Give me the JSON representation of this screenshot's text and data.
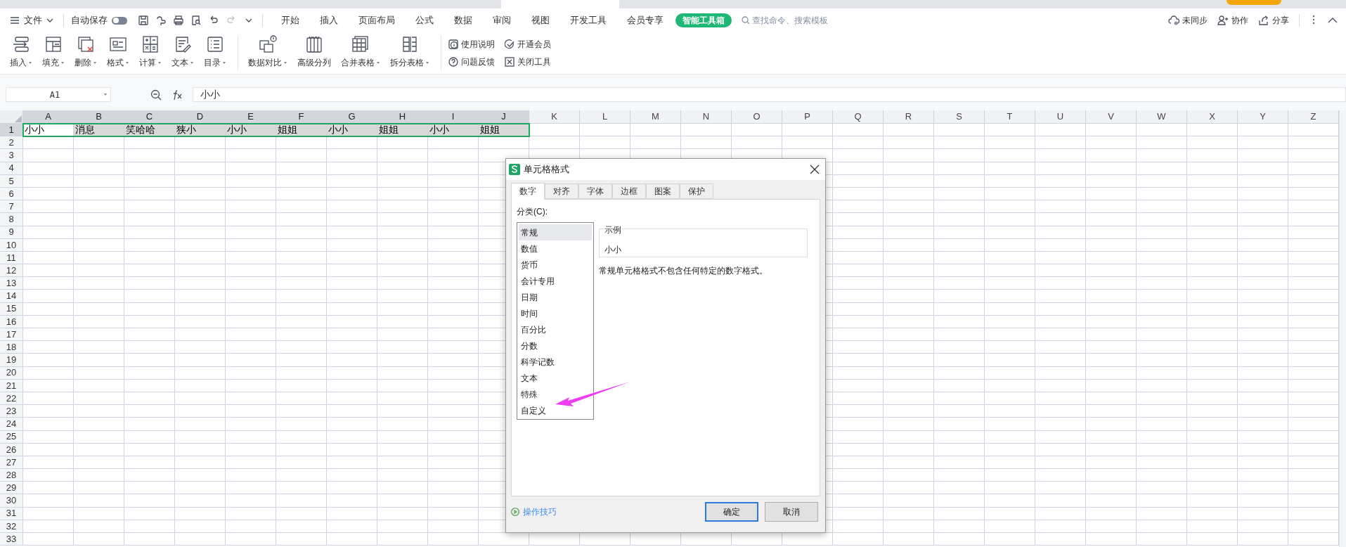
{
  "menu": {
    "file": "文件",
    "autosave": {
      "label": "自动保存",
      "on": false
    },
    "tabs": [
      {
        "label": "开始",
        "selected": false
      },
      {
        "label": "插入",
        "selected": false
      },
      {
        "label": "页面布局",
        "selected": false
      },
      {
        "label": "公式",
        "selected": false
      },
      {
        "label": "数据",
        "selected": false
      },
      {
        "label": "审阅",
        "selected": false
      },
      {
        "label": "视图",
        "selected": false
      },
      {
        "label": "开发工具",
        "selected": false
      },
      {
        "label": "会员专享",
        "selected": false
      },
      {
        "label": "智能工具箱",
        "selected": true
      }
    ],
    "search": {
      "placeholder": "查找命令、搜索模板"
    },
    "actions": [
      "未同步",
      "协作",
      "分享"
    ]
  },
  "ribbon": {
    "groups": [
      [
        {
          "label": "插入",
          "dropdown": true
        },
        {
          "label": "填充",
          "dropdown": true
        },
        {
          "label": "删除",
          "dropdown": true
        },
        {
          "label": "格式",
          "dropdown": true
        },
        {
          "label": "计算",
          "dropdown": true
        },
        {
          "label": "文本",
          "dropdown": true
        },
        {
          "label": "目录",
          "dropdown": true
        }
      ],
      [
        {
          "label": "数据对比",
          "dropdown": true
        },
        {
          "label": "高级分列",
          "dropdown": false
        },
        {
          "label": "合并表格",
          "dropdown": true
        },
        {
          "label": "拆分表格",
          "dropdown": true
        }
      ]
    ],
    "links": [
      "使用说明",
      "问题反馈",
      "开通会员",
      "关闭工具"
    ]
  },
  "formula_bar": {
    "cell_ref": "A1",
    "value": "小小"
  },
  "sheet": {
    "columns": [
      {
        "label": "A",
        "selected": true
      },
      {
        "label": "B",
        "selected": true
      },
      {
        "label": "C",
        "selected": true
      },
      {
        "label": "D",
        "selected": true
      },
      {
        "label": "E",
        "selected": true
      },
      {
        "label": "F",
        "selected": true
      },
      {
        "label": "G",
        "selected": true
      },
      {
        "label": "H",
        "selected": true
      },
      {
        "label": "I",
        "selected": true
      },
      {
        "label": "J",
        "selected": true
      },
      {
        "label": "K",
        "selected": false
      },
      {
        "label": "L",
        "selected": false
      },
      {
        "label": "M",
        "selected": false
      },
      {
        "label": "N",
        "selected": false
      },
      {
        "label": "O",
        "selected": false
      },
      {
        "label": "P",
        "selected": false
      },
      {
        "label": "Q",
        "selected": false
      },
      {
        "label": "R",
        "selected": false
      },
      {
        "label": "S",
        "selected": false
      },
      {
        "label": "T",
        "selected": false
      },
      {
        "label": "U",
        "selected": false
      },
      {
        "label": "V",
        "selected": false
      },
      {
        "label": "W",
        "selected": false
      },
      {
        "label": "X",
        "selected": false
      },
      {
        "label": "Y",
        "selected": false
      },
      {
        "label": "Z",
        "selected": false
      }
    ],
    "rows": [
      {
        "label": "1",
        "selected": true,
        "cells": [
          {
            "value": "小小",
            "active": true
          },
          {
            "value": "消息",
            "active": false
          },
          {
            "value": "笑哈哈",
            "active": false
          },
          {
            "value": "狭小",
            "active": false
          },
          {
            "value": "小小",
            "active": false
          },
          {
            "value": "姐姐",
            "active": false
          },
          {
            "value": "小小",
            "active": false
          },
          {
            "value": "姐姐",
            "active": false
          },
          {
            "value": "小小",
            "active": false
          },
          {
            "value": "姐姐",
            "active": false
          }
        ]
      },
      {
        "label": "2",
        "selected": false
      },
      {
        "label": "3",
        "selected": false
      },
      {
        "label": "4",
        "selected": false
      },
      {
        "label": "5",
        "selected": false
      },
      {
        "label": "6",
        "selected": false
      },
      {
        "label": "7",
        "selected": false
      },
      {
        "label": "8",
        "selected": false
      },
      {
        "label": "9",
        "selected": false
      },
      {
        "label": "10",
        "selected": false
      },
      {
        "label": "11",
        "selected": false
      },
      {
        "label": "12",
        "selected": false
      },
      {
        "label": "13",
        "selected": false
      },
      {
        "label": "14",
        "selected": false
      },
      {
        "label": "15",
        "selected": false
      },
      {
        "label": "16",
        "selected": false
      },
      {
        "label": "17",
        "selected": false
      },
      {
        "label": "18",
        "selected": false
      },
      {
        "label": "19",
        "selected": false
      },
      {
        "label": "20",
        "selected": false
      },
      {
        "label": "21",
        "selected": false
      },
      {
        "label": "22",
        "selected": false
      },
      {
        "label": "23",
        "selected": false
      },
      {
        "label": "24",
        "selected": false
      },
      {
        "label": "25",
        "selected": false
      },
      {
        "label": "26",
        "selected": false
      },
      {
        "label": "27",
        "selected": false
      },
      {
        "label": "28",
        "selected": false
      },
      {
        "label": "29",
        "selected": false
      },
      {
        "label": "30",
        "selected": false
      },
      {
        "label": "31",
        "selected": false
      },
      {
        "label": "32",
        "selected": false
      },
      {
        "label": "33",
        "selected": false
      }
    ]
  },
  "dialog": {
    "title": "单元格格式",
    "tabs": [
      {
        "label": "数字",
        "selected": true
      },
      {
        "label": "对齐",
        "selected": false
      },
      {
        "label": "字体",
        "selected": false
      },
      {
        "label": "边框",
        "selected": false
      },
      {
        "label": "图案",
        "selected": false
      },
      {
        "label": "保护",
        "selected": false
      }
    ],
    "category_label": "分类(C):",
    "categories": [
      {
        "label": "常规",
        "selected": true
      },
      {
        "label": "数值",
        "selected": false
      },
      {
        "label": "货币",
        "selected": false
      },
      {
        "label": "会计专用",
        "selected": false
      },
      {
        "label": "日期",
        "selected": false
      },
      {
        "label": "时间",
        "selected": false
      },
      {
        "label": "百分比",
        "selected": false
      },
      {
        "label": "分数",
        "selected": false
      },
      {
        "label": "科学记数",
        "selected": false
      },
      {
        "label": "文本",
        "selected": false
      },
      {
        "label": "特殊",
        "selected": false
      },
      {
        "label": "自定义",
        "selected": false
      }
    ],
    "sample": {
      "legend": "示例",
      "value": "小小"
    },
    "description": "常规单元格格式不包含任何特定的数字格式。",
    "tips_link": "操作技巧",
    "buttons": [
      {
        "label": "确定",
        "kind": "primary"
      },
      {
        "label": "取消",
        "kind": "secondary"
      }
    ]
  }
}
